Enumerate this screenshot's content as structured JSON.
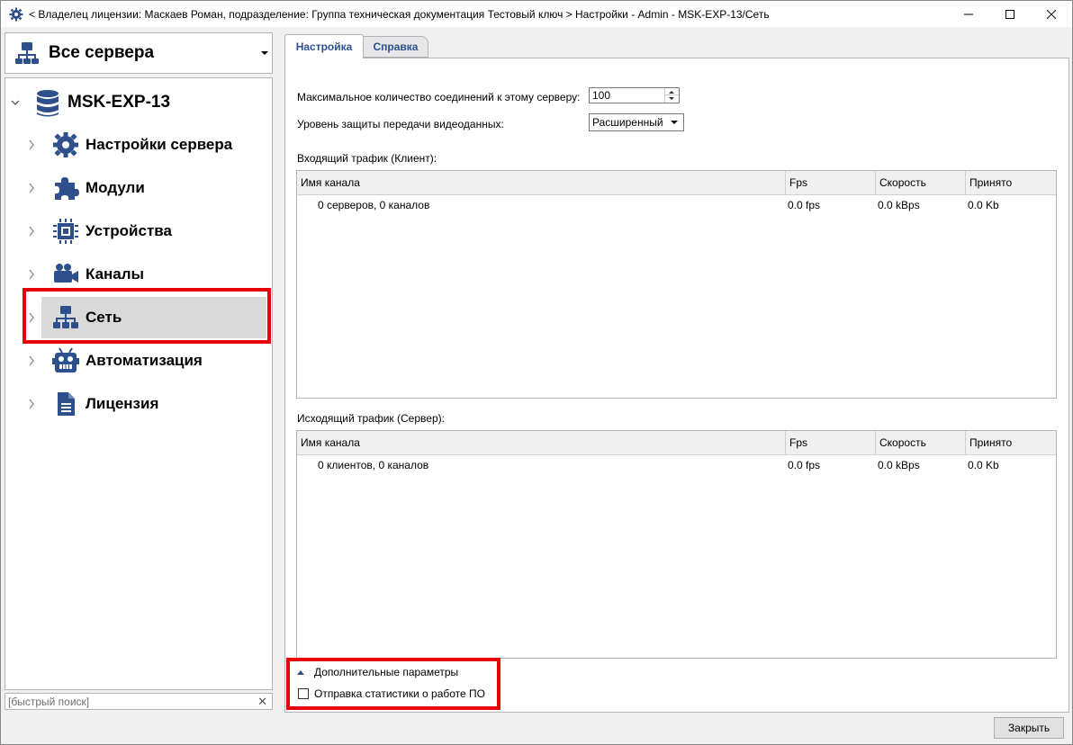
{
  "window": {
    "title": "< Владелец лицензии: Маскаев Роман, подразделение: Группа техническая документация Тестовый ключ > Настройки - Admin - MSK-EXP-13/Сеть",
    "minimize_icon": "minimize-icon",
    "maximize_icon": "maximize-icon",
    "close_icon": "close-icon"
  },
  "sidebar": {
    "server_selector": "Все сервера",
    "root": {
      "label": "MSK-EXP-13",
      "icon": "database-icon"
    },
    "items": [
      {
        "label": "Настройки сервера",
        "icon": "gear-icon"
      },
      {
        "label": "Модули",
        "icon": "puzzle-icon"
      },
      {
        "label": "Устройства",
        "icon": "chip-icon"
      },
      {
        "label": "Каналы",
        "icon": "camera-icon"
      },
      {
        "label": "Сеть",
        "icon": "network-icon",
        "selected": true
      },
      {
        "label": "Автоматизация",
        "icon": "robot-icon"
      },
      {
        "label": "Лицензия",
        "icon": "document-icon"
      }
    ],
    "search_placeholder": "[быстрый поиск]"
  },
  "tabs": [
    {
      "label": "Настройка",
      "active": true
    },
    {
      "label": "Справка",
      "active": false
    }
  ],
  "settings": {
    "max_connections_label": "Максимальное количество соединений к этому серверу:",
    "max_connections_value": "100",
    "protection_label": "Уровень защиты передачи видеоданных:",
    "protection_value": "Расширенный"
  },
  "incoming": {
    "title": "Входящий трафик (Клиент):",
    "columns": [
      "Имя канала",
      "Fps",
      "Скорость",
      "Принято"
    ],
    "row": [
      "0 серверов, 0 каналов",
      "0.0 fps",
      "0.0 kBps",
      "0.0 Kb"
    ]
  },
  "outgoing": {
    "title": "Исходящий трафик (Сервер):",
    "columns": [
      "Имя канала",
      "Fps",
      "Скорость",
      "Принято"
    ],
    "row": [
      "0 клиентов, 0 каналов",
      "0.0 fps",
      "0.0 kBps",
      "0.0 Kb"
    ]
  },
  "advanced": {
    "toggle_label": "Дополнительные параметры",
    "send_stats_label": "Отправка статистики о работе ПО",
    "send_stats_checked": false
  },
  "footer": {
    "close_label": "Закрыть"
  },
  "colors": {
    "accent": "#2d4f8b",
    "highlight": "#e8000b",
    "selected_bg": "#d9d9d9"
  }
}
